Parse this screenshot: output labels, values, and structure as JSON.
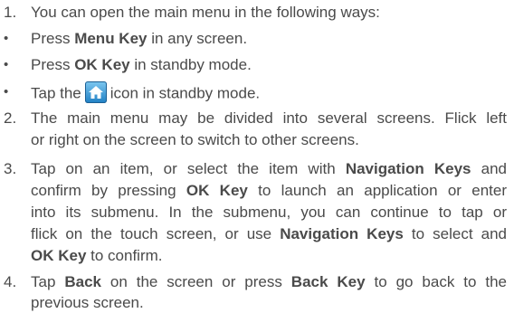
{
  "item1": {
    "num": "1.",
    "text": "You can open the main menu in the following ways:"
  },
  "bullets": [
    {
      "mark": "•",
      "pre": "Press ",
      "bold": "Menu Key",
      "post": " in any screen."
    },
    {
      "mark": "•",
      "pre": "Press ",
      "bold": "OK Key",
      "post": " in standby mode."
    },
    {
      "mark": "•",
      "pre": "Tap the",
      "icon": "home-icon",
      "post": "icon in standby mode."
    }
  ],
  "item2": {
    "num": "2.",
    "line1": "The main menu may be divided into several screens. Flick left",
    "line2": "or right on the screen to switch to other screens."
  },
  "item3": {
    "num": "3.",
    "l1_pre": "Tap on an item, or select the item with ",
    "l1_bold": "Navigation Keys",
    "l1_post": " and",
    "l2_pre": "confirm by pressing ",
    "l2_bold": "OK Key",
    "l2_post": " to launch an application or enter",
    "l3": "into its submenu. In the submenu, you can continue to tap or",
    "l4_pre": "flick on the touch screen, or use ",
    "l4_bold": "Navigation Keys",
    "l4_post": " to select and",
    "l5_bold": "OK Key",
    "l5_post": " to confirm."
  },
  "item4": {
    "num": "4.",
    "l1_a": "Tap ",
    "l1_bold1": "Back",
    "l1_b": " on the screen or press ",
    "l1_bold2": "Back Key",
    "l1_c": " to go back to the",
    "l2": "previous screen."
  },
  "colors": {
    "text": "#4a4a4a",
    "icon_top": "#7ec8f0",
    "icon_bottom": "#1f7fc4"
  }
}
